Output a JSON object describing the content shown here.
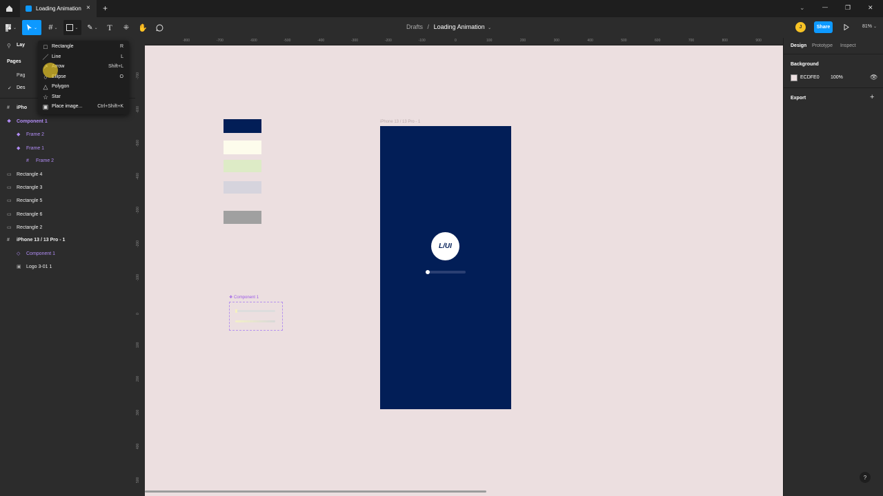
{
  "window": {
    "tab_title": "Loading Animation",
    "new_tab": "+",
    "controls": {
      "dropdown": "⌄",
      "minimize": "—",
      "restore": "❐",
      "close": "✕"
    }
  },
  "toolbar": {
    "breadcrumb_drafts": "Drafts",
    "breadcrumb_sep": "/",
    "breadcrumb_file": "Loading Animation",
    "avatar_initial": "J",
    "share_label": "Share",
    "zoom_label": "81%"
  },
  "shape_menu": [
    {
      "icon": "rectangle-icon",
      "glyph": "□",
      "label": "Rectangle",
      "shortcut": "R"
    },
    {
      "icon": "line-icon",
      "glyph": "／",
      "label": "Line",
      "shortcut": "L"
    },
    {
      "icon": "arrow-icon",
      "glyph": "↗",
      "label": "Arrow",
      "shortcut": "Shift+L"
    },
    {
      "icon": "ellipse-icon",
      "glyph": "○",
      "label": "Ellipse",
      "shortcut": "O"
    },
    {
      "icon": "polygon-icon",
      "glyph": "△",
      "label": "Polygon",
      "shortcut": ""
    },
    {
      "icon": "star-icon",
      "glyph": "☆",
      "label": "Star",
      "shortcut": ""
    },
    {
      "icon": "image-icon",
      "glyph": "▣",
      "label": "Place image...",
      "shortcut": "Ctrl+Shift+K"
    }
  ],
  "left_panel": {
    "layers_tab": "Lay",
    "pages_heading": "Pages",
    "page_1": "Pag",
    "page_2": "Des",
    "layers": [
      {
        "label": "iPho",
        "icon": "#",
        "indent": 0,
        "component": false,
        "bold": true
      },
      {
        "label": "Component 1",
        "icon": "❖",
        "indent": 0,
        "component": true,
        "bold": true
      },
      {
        "label": "Frame 2",
        "icon": "◆",
        "indent": 1,
        "component": true,
        "bold": false
      },
      {
        "label": "Frame 1",
        "icon": "◆",
        "indent": 1,
        "component": true,
        "bold": false
      },
      {
        "label": "Frame 2",
        "icon": "#",
        "indent": 2,
        "component": true,
        "bold": false
      },
      {
        "label": "Rectangle 4",
        "icon": "▭",
        "indent": 0,
        "component": false,
        "bold": false
      },
      {
        "label": "Rectangle 3",
        "icon": "▭",
        "indent": 0,
        "component": false,
        "bold": false
      },
      {
        "label": "Rectangle 5",
        "icon": "▭",
        "indent": 0,
        "component": false,
        "bold": false
      },
      {
        "label": "Rectangle 6",
        "icon": "▭",
        "indent": 0,
        "component": false,
        "bold": false
      },
      {
        "label": "Rectangle 2",
        "icon": "▭",
        "indent": 0,
        "component": false,
        "bold": false
      },
      {
        "label": "iPhone 13 / 13 Pro - 1",
        "icon": "#",
        "indent": 0,
        "component": false,
        "bold": true
      },
      {
        "label": "Component 1",
        "icon": "◇",
        "indent": 1,
        "component": true,
        "bold": false
      },
      {
        "label": "Logo 3-01 1",
        "icon": "▣",
        "indent": 1,
        "component": false,
        "bold": false
      }
    ]
  },
  "rulers": {
    "top": [
      "-800",
      "-700",
      "-600",
      "-500",
      "-400",
      "-300",
      "-200",
      "-100",
      "0",
      "100",
      "200",
      "300",
      "400",
      "500",
      "600",
      "700",
      "800",
      "900",
      "1000"
    ],
    "left": [
      "-700",
      "-600",
      "-500",
      "-400",
      "-300",
      "-200",
      "-100",
      "0",
      "100",
      "200",
      "300",
      "400",
      "500"
    ]
  },
  "canvas": {
    "background": "#ECDFE0",
    "frame_label": "iPhone 13 / 13 Pro - 1",
    "frame_color": "#021E57",
    "logo_text": "L/UI",
    "component_label": "Component 1",
    "loading_progress": 0.05,
    "swatches": [
      "#021E57",
      "#FDFCEC",
      "#DDEBC6",
      "#D6D4DD",
      "#A0A0A0"
    ]
  },
  "right_panel": {
    "tabs": [
      "Design",
      "Prototype",
      "Inspect"
    ],
    "background_heading": "Background",
    "background_hex": "ECDFE0",
    "background_opacity": "100%",
    "export_heading": "Export",
    "export_add": "+"
  },
  "help_label": "?"
}
